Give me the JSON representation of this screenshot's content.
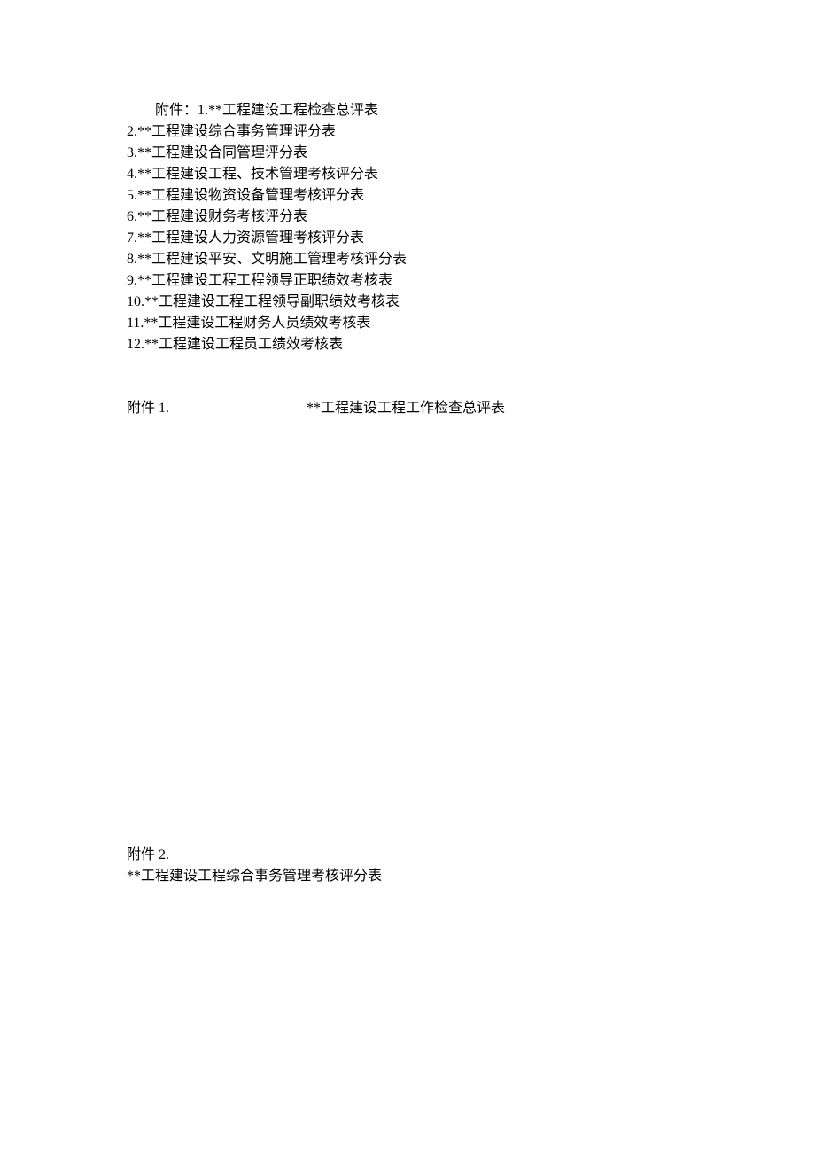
{
  "list": {
    "prefix": "附件：",
    "items": [
      "1.**工程建设工程检查总评表",
      "2.**工程建设综合事务管理评分表",
      "3.**工程建设合同管理评分表",
      "4.**工程建设工程、技术管理考核评分表",
      "5.**工程建设物资设备管理考核评分表",
      "6.**工程建设财务考核评分表",
      "7.**工程建设人力资源管理考核评分表",
      "8.**工程建设平安、文明施工管理考核评分表",
      "9.**工程建设工程工程领导正职绩效考核表",
      "10.**工程建设工程工程领导副职绩效考核表",
      "11.**工程建设工程财务人员绩效考核表",
      "12.**工程建设工程员工绩效考核表"
    ]
  },
  "section1": {
    "label": "附件 1.",
    "title": "**工程建设工程工作检查总评表"
  },
  "section2": {
    "label": "附件 2.",
    "title": "**工程建设工程综合事务管理考核评分表"
  }
}
